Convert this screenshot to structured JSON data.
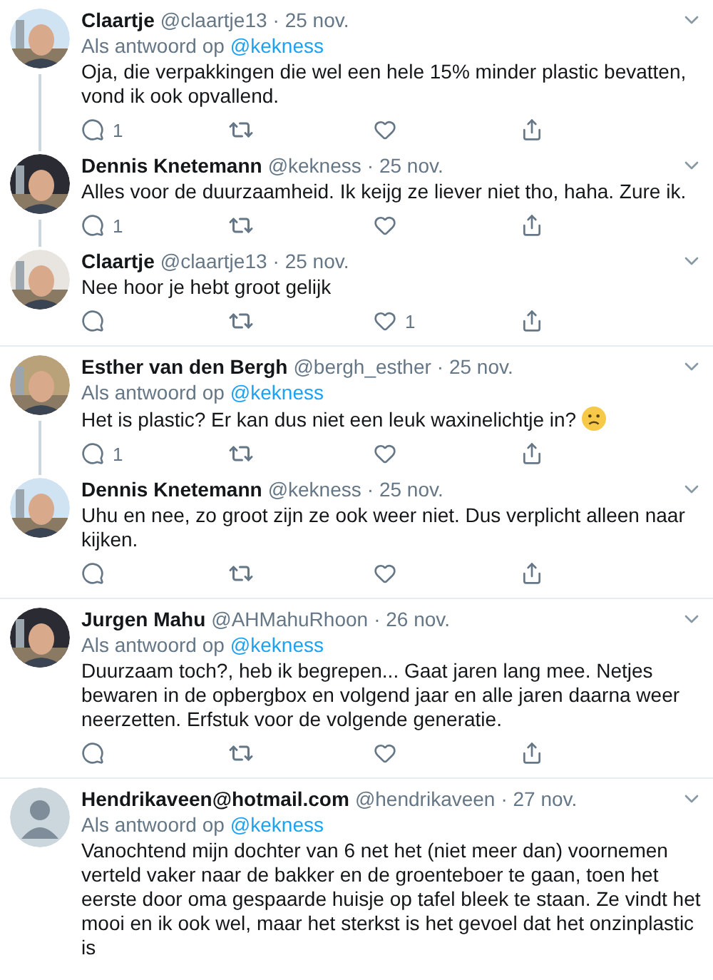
{
  "tweets": [
    {
      "name": "Claartje",
      "handle": "@claartje13",
      "date": "· 25 nov.",
      "reply_prefix": "Als antwoord op",
      "reply_to": "@kekness",
      "text": "Oja, die verpakkingen die wel een hele 15% minder plastic bevatten, vond ik ook opvallend.",
      "reply_count": "1",
      "thread_line": true
    },
    {
      "name": "Dennis Knetemann",
      "handle": "@kekness",
      "date": "· 25 nov.",
      "text": "Alles voor de duurzaamheid. Ik keijg ze liever niet tho, haha. Zure ik.",
      "reply_count": "1",
      "thread_line": true
    },
    {
      "name": "Claartje",
      "handle": "@claartje13",
      "date": "· 25 nov.",
      "text": "Nee hoor je hebt groot gelijk",
      "like_count": "1",
      "thread_line": false
    },
    {
      "name": "Esther van den Bergh",
      "handle": "@bergh_esther",
      "date": "· 25 nov.",
      "reply_prefix": "Als antwoord op",
      "reply_to": "@kekness",
      "text": "Het is plastic? Er kan dus niet een leuk waxinelichtje in?",
      "sad_emoji": true,
      "reply_count": "1",
      "thread_line": true
    },
    {
      "name": "Dennis Knetemann",
      "handle": "@kekness",
      "date": "· 25 nov.",
      "text": "Uhu en nee, zo groot zijn ze ook weer niet. Dus verplicht alleen naar kijken.",
      "thread_line": false
    },
    {
      "name": "Jurgen Mahu",
      "handle": "@AHMahuRhoon",
      "date": "· 26 nov.",
      "reply_prefix": "Als antwoord op",
      "reply_to": "@kekness",
      "text": "Duurzaam toch?, heb ik begrepen... Gaat jaren lang mee. Netjes bewaren in de opbergbox en volgend jaar en alle jaren daarna weer neerzetten. Erfstuk voor de volgende generatie.",
      "thread_line": false
    },
    {
      "avatar": {
        "kind": "default"
      },
      "name": "Hendrikaveen@hotmail.com",
      "handle": "@hendrikaveen",
      "date": "· 27 nov.",
      "reply_prefix": "Als antwoord op",
      "reply_to": "@kekness",
      "text": "Vanochtend mijn dochter van 6 net het (niet meer dan) voornemen verteld vaker naar de bakker en de groenteboer te gaan, toen het eerste door oma gespaarde huisje op tafel bleek te staan. Ze vindt het mooi en ik ook wel, maar het sterkst is het gevoel dat het onzinplastic is",
      "thread_line": false,
      "cut": true
    }
  ]
}
